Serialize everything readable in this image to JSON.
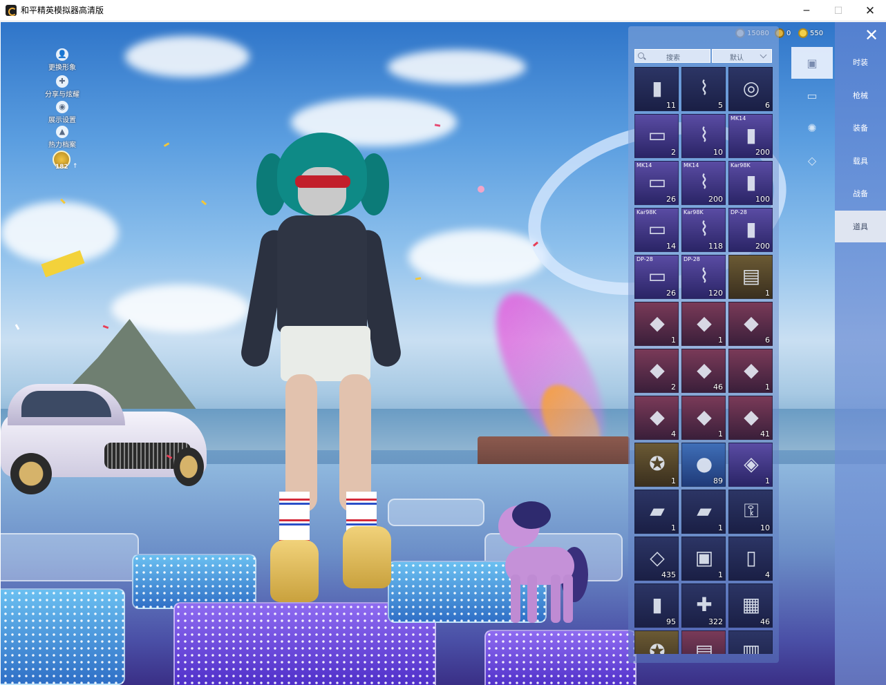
{
  "window": {
    "title": "和平精英模拟器高清版",
    "min": "─",
    "max": "☐",
    "close": "✕"
  },
  "currency": [
    {
      "icon": "silver-coin-icon",
      "value": "15080",
      "color": "#b9c3cf"
    },
    {
      "icon": "gold-coin-icon",
      "value": "0",
      "color": "#e0b33c"
    },
    {
      "icon": "star-coin-icon",
      "value": "550",
      "color": "#f3d04a"
    }
  ],
  "left_menu": [
    {
      "label": "更换形象",
      "glyph": "👤",
      "icon": "person-icon"
    },
    {
      "label": "分享与炫耀",
      "glyph": "✚",
      "icon": "share-icon"
    },
    {
      "label": "展示设置",
      "glyph": "◉",
      "icon": "eye-icon"
    },
    {
      "label": "热力档案",
      "glyph": "▲",
      "icon": "flame-icon"
    }
  ],
  "level": {
    "value": "182",
    "up": "↑"
  },
  "inventory": {
    "search_label": "搜索",
    "sort_label": "默认",
    "items": [
      {
        "glyph": "▮",
        "count": "11",
        "tag": "",
        "style": "c-dark"
      },
      {
        "glyph": "⌇",
        "count": "5",
        "tag": "",
        "style": "c-dark"
      },
      {
        "glyph": "◎",
        "count": "6",
        "tag": "",
        "style": "c-dark"
      },
      {
        "glyph": "▭",
        "count": "2",
        "tag": "",
        "style": "c-purple"
      },
      {
        "glyph": "⌇",
        "count": "10",
        "tag": "",
        "style": "c-purple"
      },
      {
        "glyph": "▮",
        "count": "200",
        "tag": "MK14",
        "style": "c-purple"
      },
      {
        "glyph": "▭",
        "count": "26",
        "tag": "MK14",
        "style": "c-purple"
      },
      {
        "glyph": "⌇",
        "count": "200",
        "tag": "MK14",
        "style": "c-purple"
      },
      {
        "glyph": "▮",
        "count": "100",
        "tag": "Kar98K",
        "style": "c-purple"
      },
      {
        "glyph": "▭",
        "count": "14",
        "tag": "Kar98K",
        "style": "c-purple"
      },
      {
        "glyph": "⌇",
        "count": "118",
        "tag": "Kar98K",
        "style": "c-purple"
      },
      {
        "glyph": "▮",
        "count": "200",
        "tag": "DP-28",
        "style": "c-purple"
      },
      {
        "glyph": "▭",
        "count": "26",
        "tag": "DP-28",
        "style": "c-purple"
      },
      {
        "glyph": "⌇",
        "count": "120",
        "tag": "DP-28",
        "style": "c-purple"
      },
      {
        "glyph": "▤",
        "count": "1",
        "tag": "",
        "style": "c-gold"
      },
      {
        "glyph": "◆",
        "count": "1",
        "tag": "",
        "style": "c-red"
      },
      {
        "glyph": "◆",
        "count": "1",
        "tag": "",
        "style": "c-red"
      },
      {
        "glyph": "◆",
        "count": "6",
        "tag": "",
        "style": "c-red"
      },
      {
        "glyph": "◆",
        "count": "2",
        "tag": "",
        "style": "c-red"
      },
      {
        "glyph": "◆",
        "count": "46",
        "tag": "",
        "style": "c-red"
      },
      {
        "glyph": "◆",
        "count": "1",
        "tag": "",
        "style": "c-red"
      },
      {
        "glyph": "◆",
        "count": "4",
        "tag": "",
        "style": "c-red"
      },
      {
        "glyph": "◆",
        "count": "1",
        "tag": "",
        "style": "c-red"
      },
      {
        "glyph": "◆",
        "count": "41",
        "tag": "",
        "style": "c-red"
      },
      {
        "glyph": "✪",
        "count": "1",
        "tag": "",
        "style": "c-gold"
      },
      {
        "glyph": "●",
        "count": "89",
        "tag": "",
        "style": "c-blue"
      },
      {
        "glyph": "◈",
        "count": "1",
        "tag": "",
        "style": "c-purple"
      },
      {
        "glyph": "▰",
        "count": "1",
        "tag": "",
        "style": "c-dark"
      },
      {
        "glyph": "▰",
        "count": "1",
        "tag": "",
        "style": "c-dark"
      },
      {
        "glyph": "⚿",
        "count": "10",
        "tag": "",
        "style": "c-dark"
      },
      {
        "glyph": "◇",
        "count": "435",
        "tag": "",
        "style": "c-dark"
      },
      {
        "glyph": "▣",
        "count": "1",
        "tag": "",
        "style": "c-dark"
      },
      {
        "glyph": "▯",
        "count": "4",
        "tag": "",
        "style": "c-dark"
      },
      {
        "glyph": "▮",
        "count": "95",
        "tag": "",
        "style": "c-dark"
      },
      {
        "glyph": "✚",
        "count": "322",
        "tag": "",
        "style": "c-dark"
      },
      {
        "glyph": "▦",
        "count": "46",
        "tag": "",
        "style": "c-dark"
      },
      {
        "glyph": "✪",
        "count": "",
        "tag": "",
        "style": "c-gold"
      },
      {
        "glyph": "▤",
        "count": "",
        "tag": "",
        "style": "c-red"
      },
      {
        "glyph": "▥",
        "count": "",
        "tag": "",
        "style": "c-dark"
      }
    ]
  },
  "sub_tabs": [
    {
      "glyph": "▣",
      "icon": "cards-icon",
      "active": true
    },
    {
      "glyph": "▭",
      "icon": "case-icon",
      "active": false
    },
    {
      "glyph": "✺",
      "icon": "firework-icon",
      "active": false
    },
    {
      "glyph": "◇",
      "icon": "ticket-icon",
      "active": false
    }
  ],
  "categories": [
    {
      "label": "时装",
      "active": false
    },
    {
      "label": "枪械",
      "active": false
    },
    {
      "label": "装备",
      "active": false
    },
    {
      "label": "载具",
      "active": false
    },
    {
      "label": "战备",
      "active": false
    },
    {
      "label": "道具",
      "active": true
    }
  ],
  "close_glyph": "✕"
}
